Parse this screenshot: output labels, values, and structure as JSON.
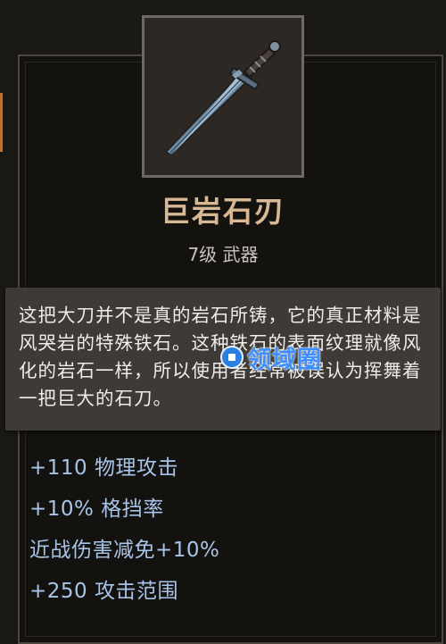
{
  "item": {
    "name": "巨岩石刃",
    "subtitle": "7级 武器",
    "icon": "greatsword-icon"
  },
  "description": "这把大刀并不是真的岩石所铸，它的真正材料是风哭岩的特殊铁石。这种铁石的表面纹理就像风化的岩石一样，所以使用者经常被误认为挥舞着一把巨大的石刀。",
  "watermark": {
    "text": "领域圈",
    "icon": "logo-icon"
  },
  "stats": [
    "+110 物理攻击",
    "+10% 格挡率",
    "近战伤害减免+10%",
    "+250 攻击范围"
  ],
  "colors": {
    "background": "#1b1916",
    "item_name": "#d8b794",
    "stat_text": "#a8c4e8",
    "tooltip_bg": "#3e3b36",
    "accent_tab": "#b8733a"
  }
}
